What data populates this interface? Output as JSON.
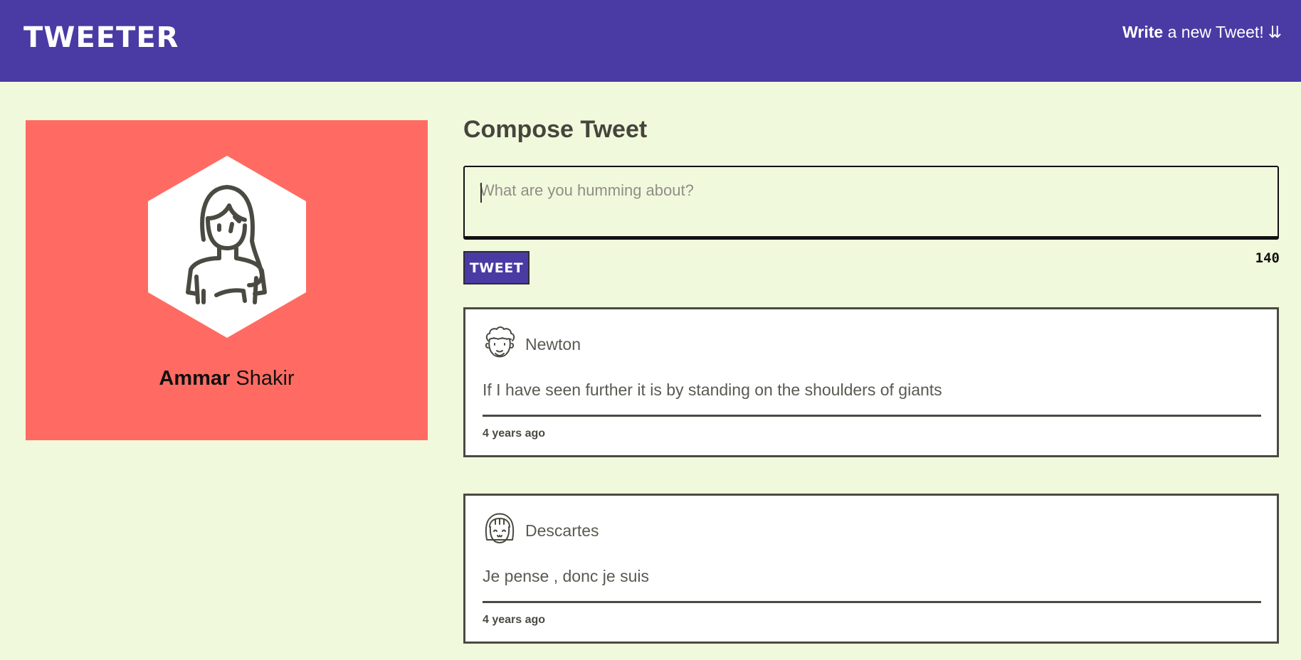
{
  "header": {
    "brand": "TWEETER",
    "write_bold": "Write",
    "write_rest": " a new Tweet!",
    "write_arrows": "⇊"
  },
  "profile": {
    "first_name": "Ammar",
    "last_name": "Shakir",
    "avatar_icon": "woman-avatar-icon",
    "card_color": "#ff6b62"
  },
  "compose": {
    "title": "Compose Tweet",
    "placeholder": "What are you humming about?",
    "value": "",
    "button_label": "TWEET",
    "char_count": "140"
  },
  "tweets": [
    {
      "author": "Newton",
      "avatar_icon": "curly-hair-man-avatar-icon",
      "text": "If I have seen further it is by standing on the shoulders of giants",
      "time": "4 years ago"
    },
    {
      "author": "Descartes",
      "avatar_icon": "bob-hair-avatar-icon",
      "text": "Je pense , donc je suis",
      "time": "4 years ago"
    }
  ],
  "colors": {
    "nav": "#4a3aa4",
    "background": "#f1f9dc",
    "profile_card": "#ff6b62",
    "tweet_border": "#4a4a42"
  }
}
